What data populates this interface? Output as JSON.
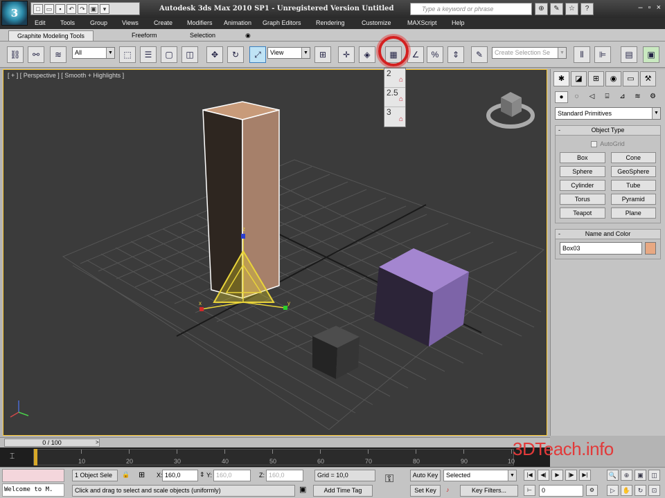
{
  "window": {
    "title": "Autodesk 3ds Max  2010 SP1  -  Unregistered Version    Untitled",
    "search_placeholder": "Type a keyword or phrase",
    "logo": "3"
  },
  "quick_access": [
    "new-icon",
    "open-icon",
    "save-icon",
    "undo-icon",
    "redo-icon",
    "project-icon"
  ],
  "help_icons": [
    {
      "name": "binoculars-icon",
      "glyph": "⊕"
    },
    {
      "name": "comm-center-icon",
      "glyph": "✎"
    },
    {
      "name": "favorites-icon",
      "glyph": "☆"
    },
    {
      "name": "help-icon",
      "glyph": "?"
    }
  ],
  "menu": [
    "Edit",
    "Tools",
    "Group",
    "Views",
    "Create",
    "Modifiers",
    "Animation",
    "Graph Editors",
    "Rendering",
    "Customize",
    "MAXScript",
    "Help"
  ],
  "ribbon_tabs": [
    "Graphite Modeling Tools",
    "Freeform",
    "Selection"
  ],
  "toolbar": {
    "filter_value": "All",
    "coord_value": "View",
    "selection_set_placeholder": "Create Selection Se"
  },
  "render_flyout": [
    "2",
    "2.5",
    "3"
  ],
  "viewport": {
    "label": "[ + ] [ Perspective ] [ Smooth + Highlights ]",
    "gizmo_z": "z",
    "gizmo_x": "x",
    "gizmo_y": "y"
  },
  "command_panel": {
    "category": "Standard Primitives",
    "object_type_title": "Object Type",
    "autogrid": "AutoGrid",
    "buttons": [
      "Box",
      "Cone",
      "Sphere",
      "GeoSphere",
      "Cylinder",
      "Tube",
      "Torus",
      "Pyramid",
      "Teapot",
      "Plane"
    ],
    "name_color_title": "Name and Color",
    "object_name": "Box03",
    "object_color": "#e8a882"
  },
  "time_slider": {
    "position": "0 / 100",
    "next": ">"
  },
  "trackbar": {
    "ticks": [
      "10",
      "20",
      "30",
      "40",
      "50",
      "60",
      "70",
      "80",
      "90",
      "10"
    ]
  },
  "status": {
    "maxscript_text": "Welcome to M.",
    "selection_info": "1 Object Sele",
    "x_label": "X:",
    "x_value": "160,0",
    "y_label": "Y:",
    "y_value": "160,0",
    "z_label": "Z:",
    "z_value": "160,0",
    "grid": "Grid = 10,0",
    "prompt": "Click and drag to select and scale objects (uniformly)",
    "add_time_tag": "Add Time Tag",
    "auto_key": "Auto Key",
    "set_key": "Set Key",
    "key_mode": "Selected",
    "key_filters": "Key Filters...",
    "frame": "0"
  },
  "watermark": "3DTeach.info"
}
